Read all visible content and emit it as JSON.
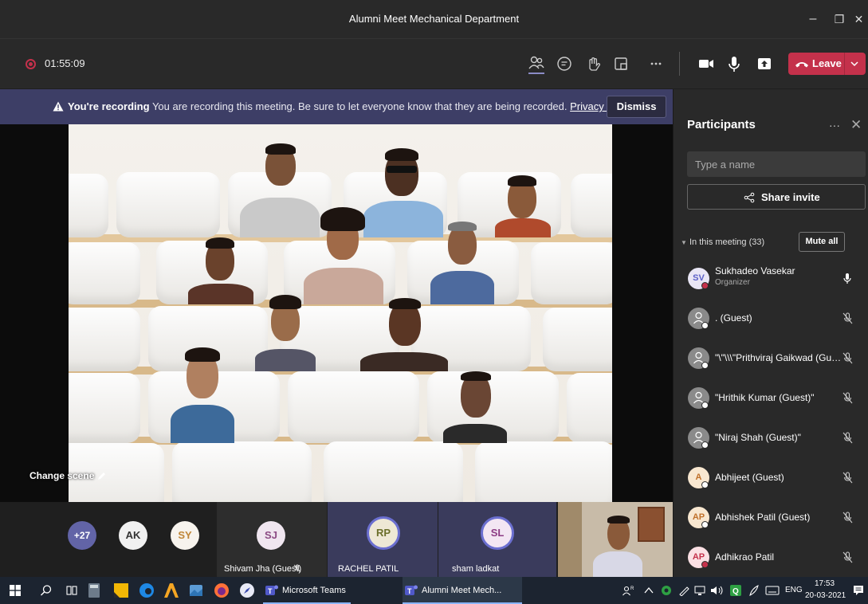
{
  "window": {
    "title": "Alumni Meet Mechanical Department",
    "minimize": "–",
    "restore": "❐",
    "close": "✕"
  },
  "toolbar": {
    "timer": "01:55:09",
    "leave_label": "Leave"
  },
  "banner": {
    "bold": "You're recording",
    "message": "You are recording this meeting. Be sure to let everyone know that they are being recorded.",
    "link": "Privacy policy",
    "dismiss": "Dismiss"
  },
  "stage": {
    "change_scene": "Change scene"
  },
  "strip": {
    "overflow_count": "+27",
    "tiles": [
      {
        "initials": "AK",
        "color": "#444",
        "ring": "#555",
        "text": "#f0f0f0",
        "name": ""
      },
      {
        "initials": "SY",
        "color": "#f7f3ed",
        "ring": "#f7f3ed",
        "text": "#c0873a",
        "name": ""
      },
      {
        "initials": "SJ",
        "color": "#f0e6f0",
        "ring": "#f0e6f0",
        "text": "#8c4b84",
        "name": "Shivam Jha (Guest)"
      },
      {
        "initials": "RP",
        "color": "#eee8d5",
        "ring": "#6b6fd0",
        "text": "#6b6f2a",
        "name": "RACHEL PATIL"
      },
      {
        "initials": "SL",
        "color": "#f3e6f3",
        "ring": "#6b6fd0",
        "text": "#8c3b84",
        "name": "sham ladkat"
      }
    ]
  },
  "panel": {
    "title": "Participants",
    "more": "···",
    "close": "✕",
    "search_placeholder": "Type a name",
    "share_invite": "Share invite",
    "in_meeting": "In this meeting (33)",
    "mute_all": "Mute all",
    "participants": [
      {
        "initials": "SV",
        "name": "Sukhadeo Vasekar",
        "role": "Organizer",
        "avatar_color": "#e9e6f5",
        "avatar_text": "#5b5fc7",
        "status": "#c4314b",
        "mic": "on"
      },
      {
        "initials": "",
        "name": ". (Guest)",
        "role": "",
        "avatar_color": "#8a8a8a",
        "avatar_text": "#fff",
        "status": "#fff",
        "mic": "off"
      },
      {
        "initials": "",
        "name": "\"\\\"\\\\\\\"Prithviraj Gaikwad (Gue...",
        "role": "",
        "avatar_color": "#8a8a8a",
        "avatar_text": "#fff",
        "status": "#fff",
        "mic": "off"
      },
      {
        "initials": "",
        "name": "\"Hrithik Kumar (Guest)\"",
        "role": "",
        "avatar_color": "#8a8a8a",
        "avatar_text": "#fff",
        "status": "#fff",
        "mic": "off"
      },
      {
        "initials": "",
        "name": "\"Niraj Shah (Guest)\"",
        "role": "",
        "avatar_color": "#8a8a8a",
        "avatar_text": "#fff",
        "status": "#fff",
        "mic": "off"
      },
      {
        "initials": "A",
        "name": "Abhijeet (Guest)",
        "role": "",
        "avatar_color": "#f8e7d0",
        "avatar_text": "#c0702a",
        "status": "#fff",
        "mic": "off"
      },
      {
        "initials": "AP",
        "name": "Abhishek Patil (Guest)",
        "role": "",
        "avatar_color": "#f8e7d0",
        "avatar_text": "#c0702a",
        "status": "#fff",
        "mic": "off"
      },
      {
        "initials": "AP",
        "name": "Adhikrao Patil",
        "role": "",
        "avatar_color": "#fbe0e4",
        "avatar_text": "#c4314b",
        "status": "#c4314b",
        "mic": "off"
      }
    ]
  },
  "taskbar": {
    "apps": [
      {
        "label": "Microsoft Teams"
      },
      {
        "label": "Alumni Meet Mech..."
      }
    ],
    "lang": "ENG",
    "time": "17:53",
    "date": "20-03-2021"
  }
}
